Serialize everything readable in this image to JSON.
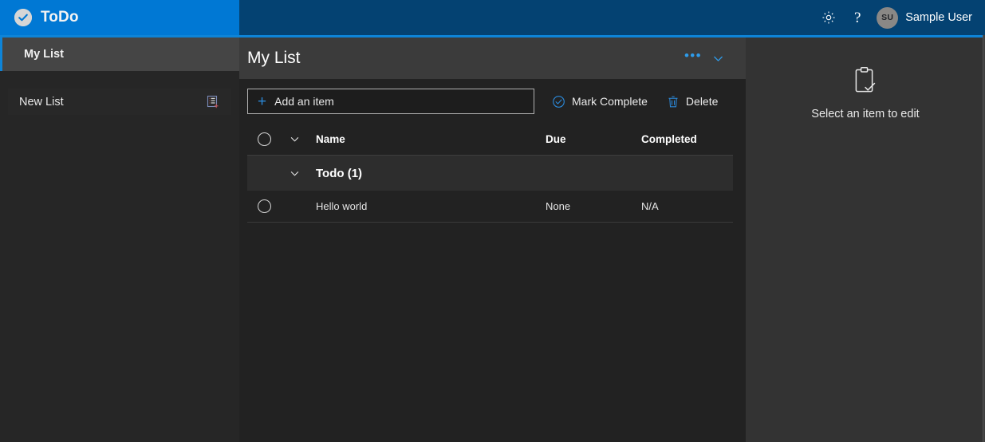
{
  "header": {
    "brand_title": "ToDo",
    "brand_logo_icon": "check-circle-icon",
    "settings_icon": "gear-icon",
    "help_label": "?",
    "avatar_initials": "SU",
    "user_name": "Sample User",
    "brand_bg": "#0078d4",
    "bar_bg": "#044272"
  },
  "sidebar": {
    "items": [
      {
        "label": "My List",
        "selected": true
      }
    ],
    "new_list": {
      "placeholder": "New List",
      "value": "",
      "icon": "add-list-icon"
    },
    "accent_color": "#0d84d8"
  },
  "list_pane": {
    "title": "My List",
    "ellipsis_label": "•••",
    "chevron_icon": "chevron-down-icon",
    "toolbar": {
      "add_item_placeholder": "Add an item",
      "add_item_value": "",
      "add_item_icon": "plus-icon",
      "mark_complete_label": "Mark Complete",
      "mark_complete_icon": "check-circle-outline-icon",
      "delete_label": "Delete",
      "delete_icon": "trash-icon"
    },
    "table": {
      "select_all_icon": "circle-icon",
      "expand_icon": "chevron-down-icon",
      "columns": [
        "Name",
        "Due",
        "Completed"
      ],
      "groups": [
        {
          "label": "Todo (1)",
          "expanded": true,
          "rows": [
            {
              "name": "Hello world",
              "due": "None",
              "completed": "N/A"
            }
          ]
        }
      ]
    }
  },
  "details_pane": {
    "empty_icon": "clipboard-check-icon",
    "empty_text": "Select an item to edit"
  }
}
